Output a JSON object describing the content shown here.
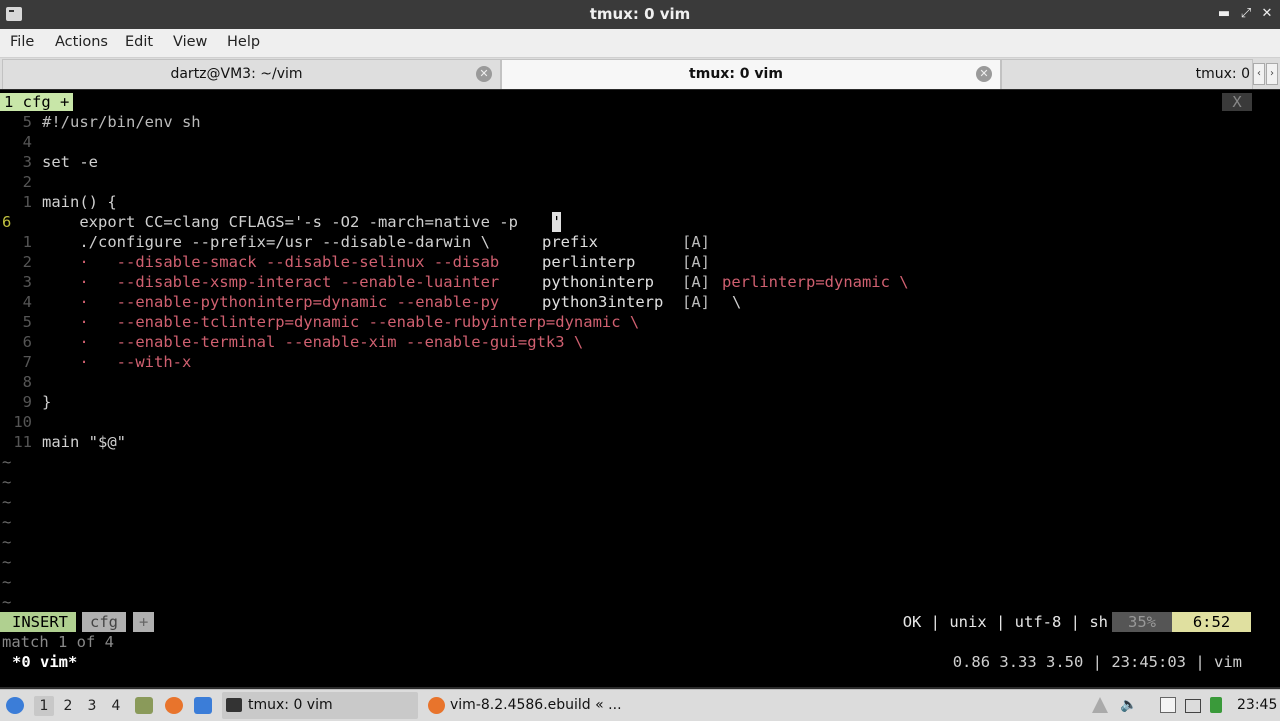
{
  "window": {
    "title": "tmux: 0 vim"
  },
  "menu": [
    "File",
    "Actions",
    "Edit",
    "View",
    "Help"
  ],
  "tabs": [
    {
      "label": "dartz@VM3: ~/vim"
    },
    {
      "label": "tmux: 0 vim"
    },
    {
      "label": "tmux: 0"
    }
  ],
  "vim": {
    "buffer_tab": "1 cfg +",
    "close_label": "X",
    "lines": [
      {
        "ln": "5",
        "text": "#!/usr/bin/env sh"
      },
      {
        "ln": "4",
        "text": ""
      },
      {
        "ln": "3",
        "text": "set -e"
      },
      {
        "ln": "2",
        "text": ""
      },
      {
        "ln": "1",
        "text": "main() {"
      },
      {
        "ln": "6",
        "text": "    export CC=clang CFLAGS='-s -O2 -march=native -p"
      },
      {
        "ln": "1",
        "text": "    ./configure --prefix=/usr --disable-darwin \\"
      },
      {
        "ln": "2",
        "text": "    ·   --disable-smack --disable-selinux --disab"
      },
      {
        "ln": "3",
        "text": "    ·   --disable-xsmp-interact --enable-luainter"
      },
      {
        "ln": "4",
        "text": "    ·   --enable-pythoninterp=dynamic --enable-py"
      },
      {
        "ln": "5",
        "text": "    ·   --enable-tclinterp=dynamic --enable-rubyinterp=dynamic \\"
      },
      {
        "ln": "6",
        "text": "    ·   --enable-terminal --enable-xim --enable-gui=gtk3 \\"
      },
      {
        "ln": "7",
        "text": "    ·   --with-x"
      },
      {
        "ln": "8",
        "text": ""
      },
      {
        "ln": "9",
        "text": "}"
      },
      {
        "ln": "10",
        "text": ""
      },
      {
        "ln": "11",
        "text": "main \"$@\""
      }
    ],
    "popup": [
      {
        "word": "prefix",
        "kind": "[A]",
        "rest": ""
      },
      {
        "word": "perlinterp",
        "kind": "[A]",
        "rest": ""
      },
      {
        "word": "pythoninterp",
        "kind": "[A]",
        "rest": "perlinterp=dynamic \\"
      },
      {
        "word": "python3interp",
        "kind": "[A]",
        "rest": "\\"
      }
    ],
    "tildes": [
      "~",
      "~",
      "~",
      "~",
      "~",
      "~",
      "~",
      "~"
    ],
    "status": {
      "mode": "INSERT",
      "file": "cfg",
      "plus": "+",
      "right": "OK | unix | utf-8 | sh",
      "percent": "35%",
      "position": "6:52"
    },
    "message": "match 1 of 4"
  },
  "tmux": {
    "left": "*0 vim*",
    "right": "0.86 3.33 3.50 | 23:45:03 | vim"
  },
  "taskbar": {
    "workspaces": [
      "1",
      "2",
      "3",
      "4"
    ],
    "tasks": [
      {
        "label": "tmux: 0 vim"
      },
      {
        "label": "vim-8.2.4586.ebuild « ..."
      }
    ],
    "clock": "23:45"
  }
}
